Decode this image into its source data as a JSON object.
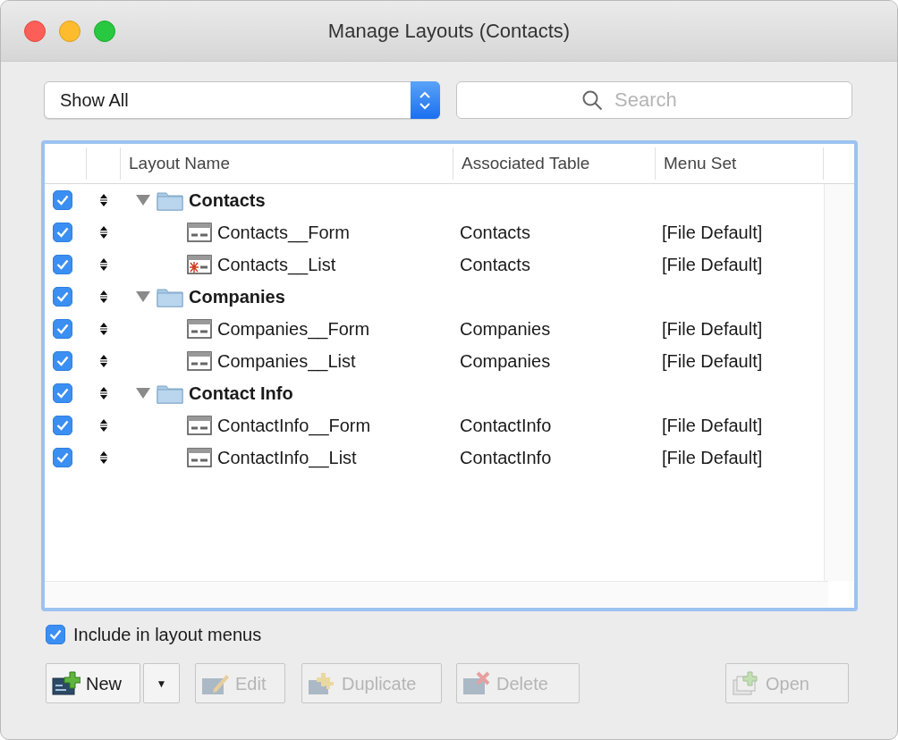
{
  "window": {
    "title": "Manage Layouts (Contacts)"
  },
  "filter": {
    "value": "Show All"
  },
  "search": {
    "placeholder": "Search"
  },
  "table": {
    "columns": [
      "Layout Name",
      "Associated Table",
      "Menu Set"
    ],
    "rows": [
      {
        "kind": "folder",
        "name": "Contacts",
        "checked": true,
        "expanded": true,
        "children": [
          {
            "kind": "layout",
            "name": "Contacts__Form",
            "table": "Contacts",
            "menu_set": "[File Default]",
            "checked": true
          },
          {
            "kind": "layout_alt",
            "name": "Contacts__List",
            "table": "Contacts",
            "menu_set": "[File Default]",
            "checked": true
          }
        ]
      },
      {
        "kind": "folder",
        "name": "Companies",
        "checked": true,
        "expanded": true,
        "children": [
          {
            "kind": "layout",
            "name": "Companies__Form",
            "table": "Companies",
            "menu_set": "[File Default]",
            "checked": true
          },
          {
            "kind": "layout",
            "name": "Companies__List",
            "table": "Companies",
            "menu_set": "[File Default]",
            "checked": true
          }
        ]
      },
      {
        "kind": "folder",
        "name": "Contact Info",
        "checked": true,
        "expanded": true,
        "children": [
          {
            "kind": "layout",
            "name": "ContactInfo__Form",
            "table": "ContactInfo",
            "menu_set": "[File Default]",
            "checked": true
          },
          {
            "kind": "layout",
            "name": "ContactInfo__List",
            "table": "ContactInfo",
            "menu_set": "[File Default]",
            "checked": true
          }
        ]
      }
    ]
  },
  "include_in_menus": {
    "label": "Include in layout menus",
    "checked": true
  },
  "buttons": [
    {
      "kind": "new",
      "label": "New",
      "disabled": false,
      "dropdown": "▼"
    },
    {
      "kind": "edit",
      "label": "Edit",
      "disabled": true
    },
    {
      "kind": "duplicate",
      "label": "Duplicate",
      "disabled": true
    },
    {
      "kind": "delete",
      "label": "Delete",
      "disabled": true
    },
    {
      "kind": "open",
      "label": "Open",
      "disabled": true
    }
  ]
}
